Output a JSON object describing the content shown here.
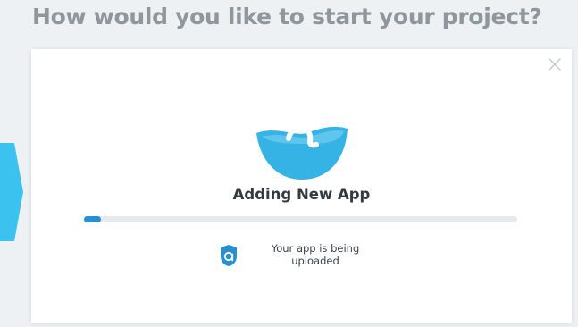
{
  "header": {
    "title": "How would you like to start your project?"
  },
  "modal": {
    "close_icon": "close-icon",
    "logo_icon": "app-logo-icon",
    "title": "Adding New App",
    "progress_fraction": 0.04,
    "status_icon": "app-shield-icon",
    "status_line1": "Your app is being",
    "status_line2": "uploaded"
  },
  "colors": {
    "background": "#eef1f4",
    "title_gray": "#8f969c",
    "accent_blue": "#2a8fd0",
    "logo_cyan": "#35b3e4",
    "arrow_cyan": "#3cc2ef",
    "progress_track": "#e7eaed"
  }
}
